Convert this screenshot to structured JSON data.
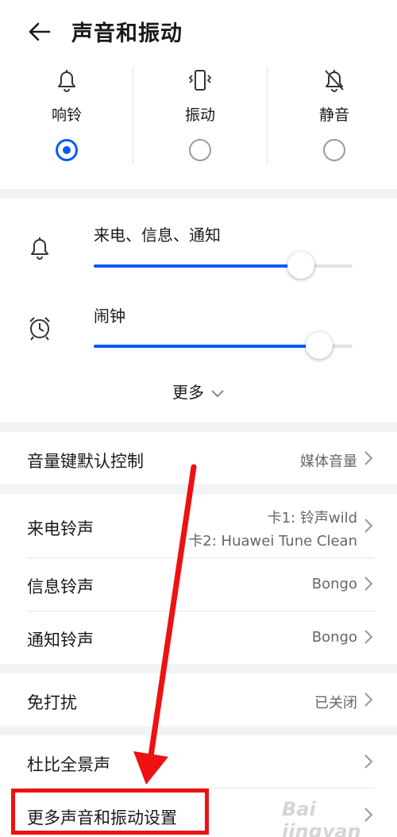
{
  "header": {
    "title": "声音和振动",
    "back_icon": "back-arrow-icon"
  },
  "modes": [
    {
      "label": "响铃",
      "icon": "bell-icon",
      "selected": true
    },
    {
      "label": "振动",
      "icon": "vibrate-icon",
      "selected": false
    },
    {
      "label": "静音",
      "icon": "bell-off-icon",
      "selected": false
    }
  ],
  "volume": {
    "call_label": "来电、信息、通知",
    "call_level": 0.8,
    "alarm_label": "闹钟",
    "alarm_level": 0.87,
    "more_label": "更多"
  },
  "settings": {
    "volume_key": {
      "label": "音量键默认控制",
      "value": "媒体音量"
    },
    "ringtone": {
      "label": "来电铃声",
      "value_line1": "卡1: 铃声wild",
      "value_line2": "卡2: Huawei Tune Clean"
    },
    "message_tone": {
      "label": "信息铃声",
      "value": "Bongo"
    },
    "notification_tone": {
      "label": "通知铃声",
      "value": "Bongo"
    },
    "dnd": {
      "label": "免打扰",
      "value": "已关闭"
    },
    "dolby": {
      "label": "杜比全景声"
    },
    "more_settings": {
      "label": "更多声音和振动设置"
    }
  },
  "overlay": {
    "watermark": "Bai jingyan",
    "highlight_color": "#ee1111"
  },
  "colors": {
    "accent": "#0a59f7",
    "annotation": "#ee1111"
  }
}
